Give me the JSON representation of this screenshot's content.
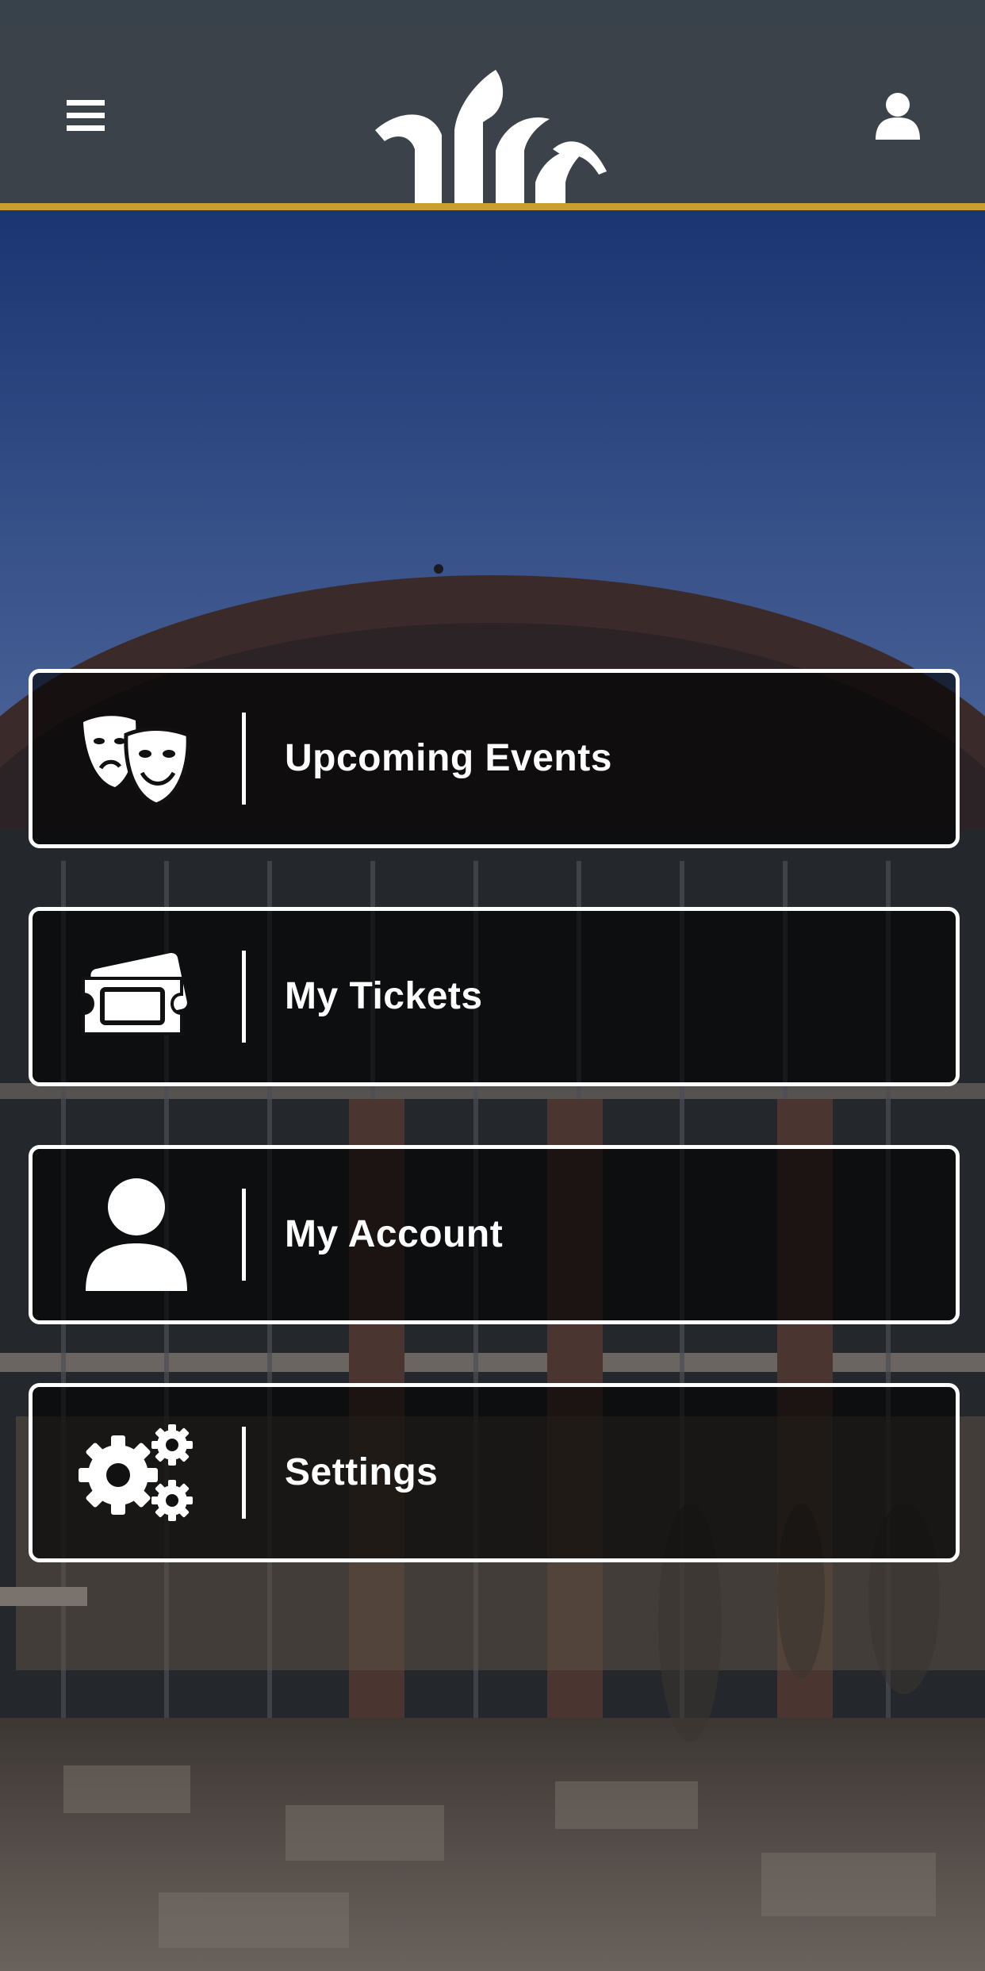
{
  "app": {
    "brand_name": "",
    "accent_color": "#c9a02f",
    "header_color": "#3b4249"
  },
  "header": {
    "menu_icon": "hamburger-menu-icon",
    "logo_icon": "venue-logo-icon",
    "profile_icon": "user-profile-icon"
  },
  "menu": {
    "items": [
      {
        "label": "Upcoming Events",
        "icon": "theater-masks-icon"
      },
      {
        "label": "My Tickets",
        "icon": "tickets-icon"
      },
      {
        "label": "My Account",
        "icon": "user-icon"
      },
      {
        "label": "Settings",
        "icon": "gears-icon"
      }
    ]
  }
}
